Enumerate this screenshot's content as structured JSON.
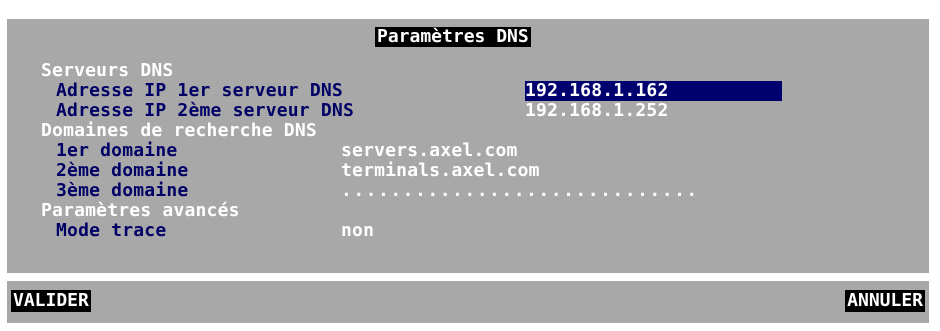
{
  "window": {
    "title": "Paramètres DNS"
  },
  "dns_servers": {
    "section_label": "Serveurs DNS",
    "server1": {
      "label": "Adresse IP 1er serveur DNS",
      "value": "192.168.1.162"
    },
    "server2": {
      "label": "Adresse IP 2ème serveur DNS",
      "value": "192.168.1.252"
    }
  },
  "search_domains": {
    "section_label": "Domaines de recherche DNS",
    "domain1": {
      "label": "1er domaine",
      "value": "servers.axel.com"
    },
    "domain2": {
      "label": "2ème domaine",
      "value": "terminals.axel.com"
    },
    "domain3": {
      "label": "3ème domaine",
      "value": "............................."
    }
  },
  "advanced": {
    "section_label": "Paramètres avancés",
    "trace_mode": {
      "label": "Mode trace",
      "value": "non"
    }
  },
  "footer": {
    "validate_label": "VALIDER",
    "cancel_label": "ANNULER"
  },
  "colors": {
    "background": "#a8a8a8",
    "label_text": "#000066",
    "section_text": "#ffffff",
    "selection": "#00006e"
  }
}
